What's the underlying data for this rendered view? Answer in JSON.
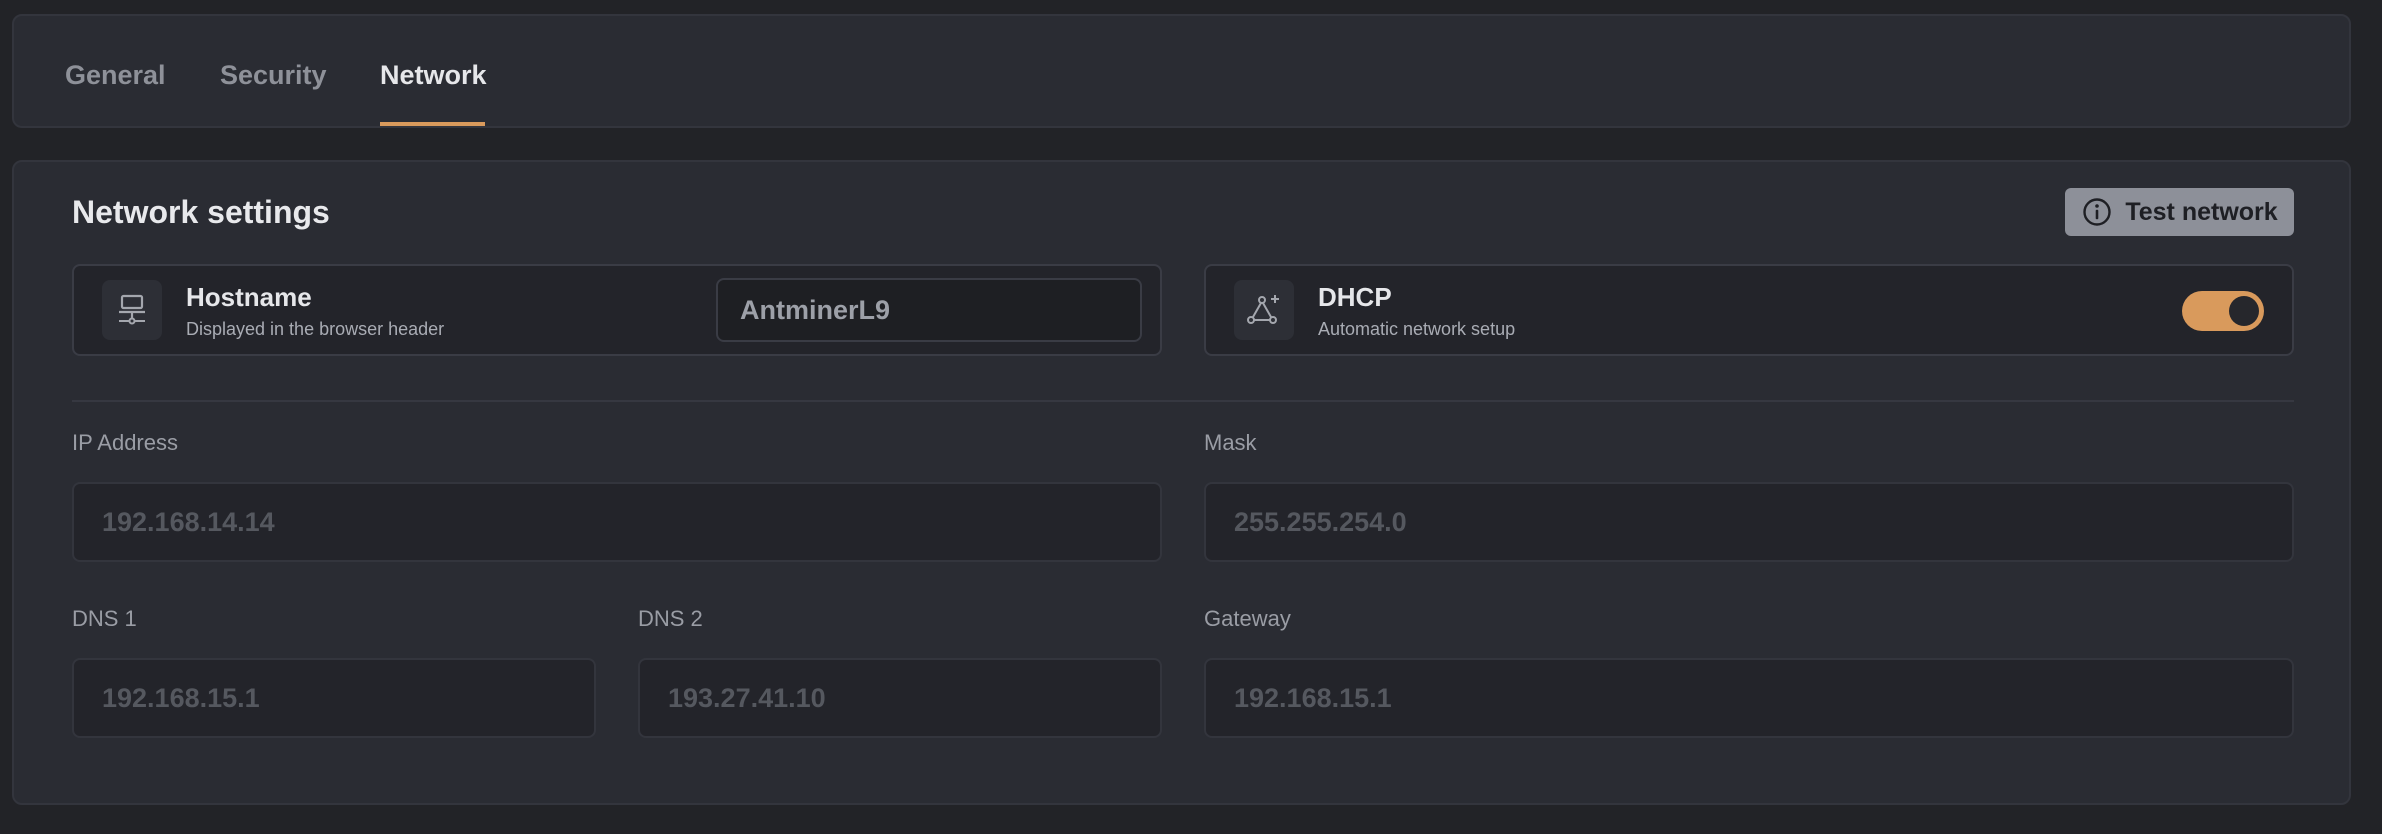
{
  "tabs": [
    {
      "label": "General",
      "active": false
    },
    {
      "label": "Security",
      "active": false
    },
    {
      "label": "Network",
      "active": true
    }
  ],
  "section": {
    "title": "Network settings",
    "test_button_label": "Test network",
    "test_button_icon": "info-icon"
  },
  "hostname": {
    "title": "Hostname",
    "subtitle": "Displayed in the browser header",
    "value": "AntminerL9",
    "icon": "network-device-icon"
  },
  "dhcp": {
    "title": "DHCP",
    "subtitle": "Automatic network setup",
    "enabled": true,
    "icon": "network-nodes-icon"
  },
  "fields": {
    "ip_address": {
      "label": "IP Address",
      "value": "192.168.14.14"
    },
    "mask": {
      "label": "Mask",
      "value": "255.255.254.0"
    },
    "dns1": {
      "label": "DNS 1",
      "value": "192.168.15.1"
    },
    "dns2": {
      "label": "DNS 2",
      "value": "193.27.41.10"
    },
    "gateway": {
      "label": "Gateway",
      "value": "192.168.15.1"
    }
  },
  "colors": {
    "accent": "#d99a5c",
    "background": "#222327",
    "card": "#2a2c33"
  }
}
